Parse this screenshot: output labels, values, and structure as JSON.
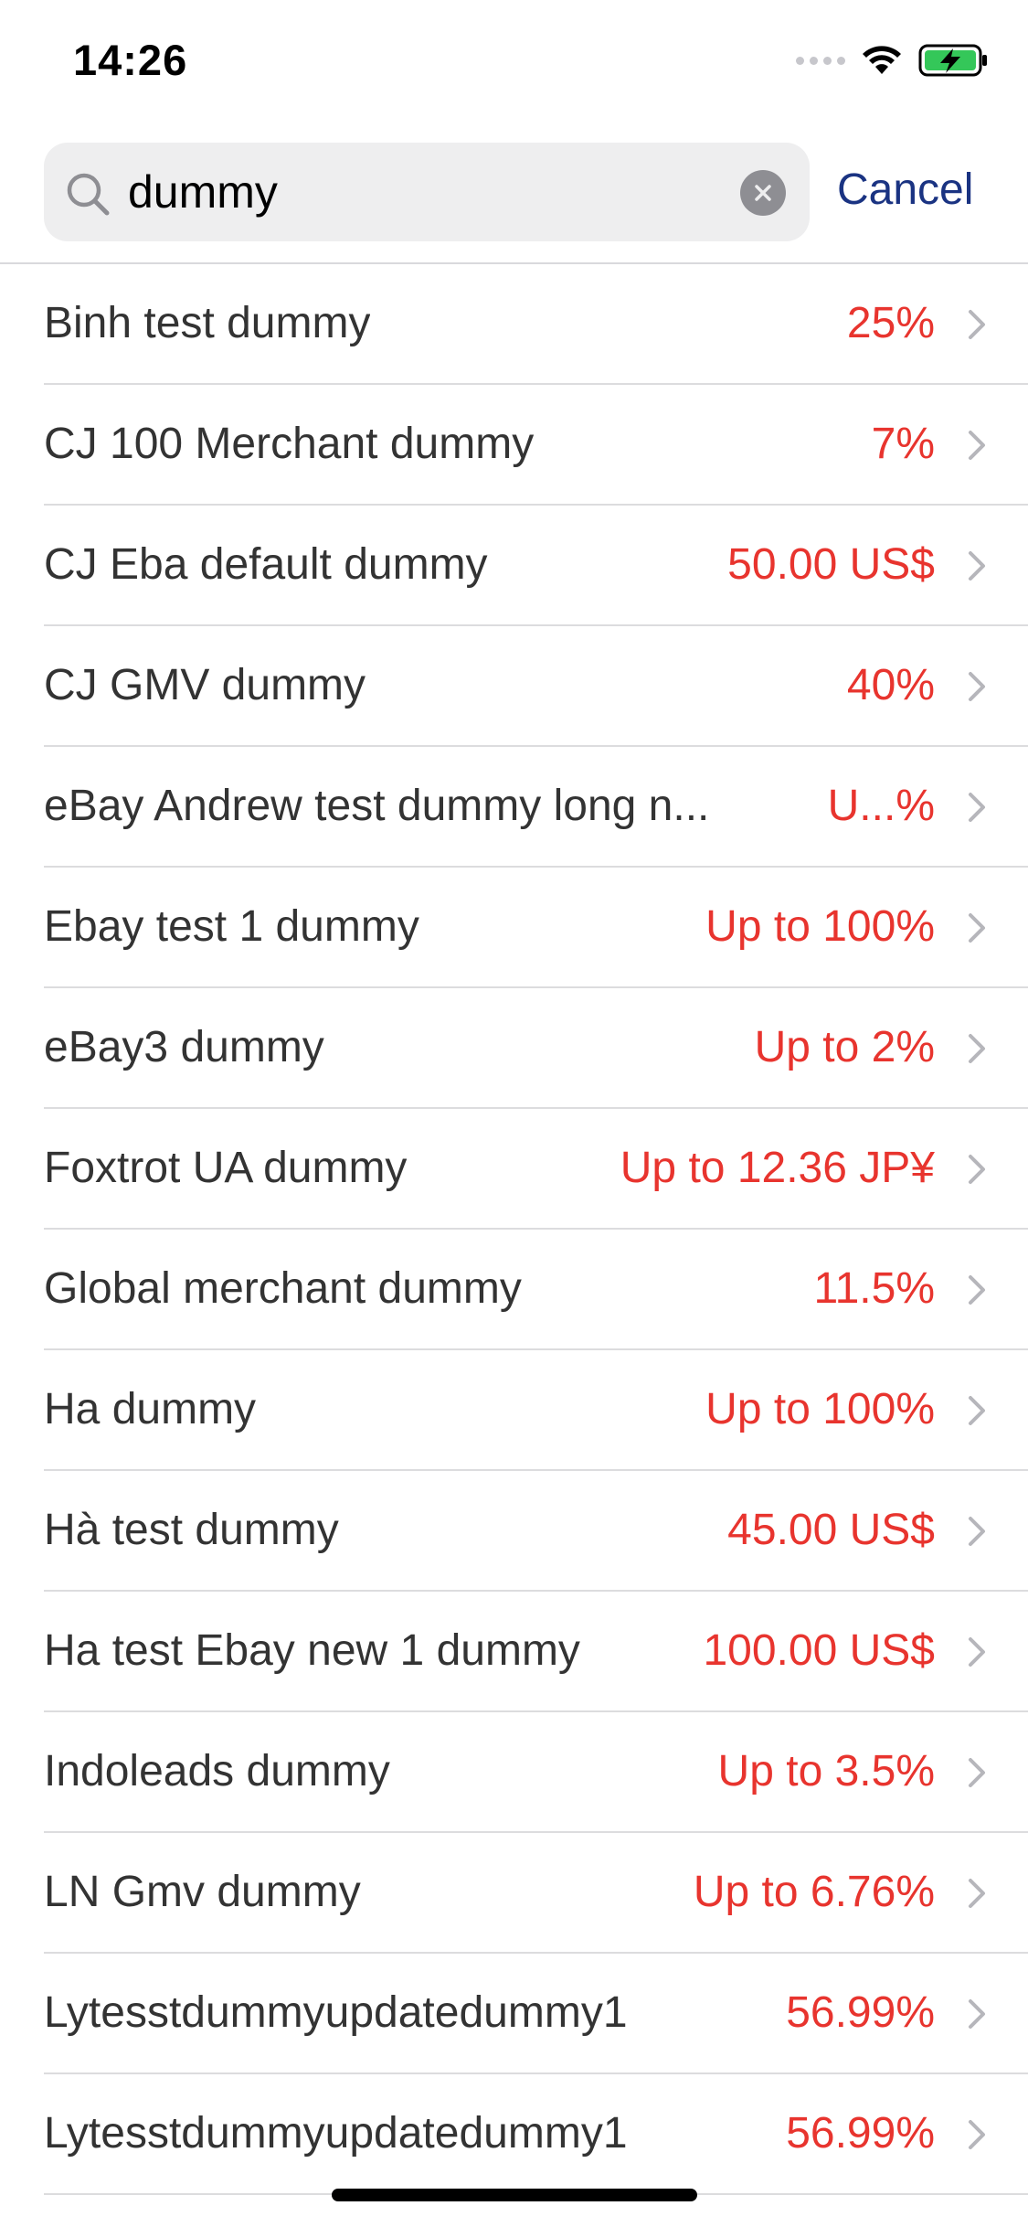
{
  "status_bar": {
    "time": "14:26"
  },
  "search": {
    "query": "dummy",
    "cancel_label": "Cancel"
  },
  "colors": {
    "accent": "#1a3382",
    "value_red": "#e8342e",
    "battery_green": "#34c759"
  },
  "results": [
    {
      "name": "Binh test dummy",
      "value": "25%"
    },
    {
      "name": "CJ 100 Merchant dummy",
      "value": "7%"
    },
    {
      "name": "CJ Eba default dummy",
      "value": "50.00 US$"
    },
    {
      "name": "CJ GMV dummy",
      "value": "40%"
    },
    {
      "name": "eBay Andrew test dummy long n...",
      "value": "U...%"
    },
    {
      "name": "Ebay test 1 dummy",
      "value": "Up to 100%"
    },
    {
      "name": "eBay3 dummy",
      "value": "Up to 2%"
    },
    {
      "name": "Foxtrot UA dummy",
      "value": "Up to 12.36 JP¥"
    },
    {
      "name": "Global merchant dummy",
      "value": "11.5%"
    },
    {
      "name": "Ha dummy",
      "value": "Up to 100%"
    },
    {
      "name": "Hà test dummy",
      "value": "45.00 US$"
    },
    {
      "name": "Ha test Ebay new 1 dummy",
      "value": "100.00 US$"
    },
    {
      "name": "Indoleads dummy",
      "value": "Up to 3.5%"
    },
    {
      "name": "LN Gmv dummy",
      "value": "Up to 6.76%"
    },
    {
      "name": "Lytesstdummyupdatedummy1",
      "value": "56.99%"
    },
    {
      "name": "Lytesstdummyupdatedummy1",
      "value": "56.99%"
    }
  ]
}
